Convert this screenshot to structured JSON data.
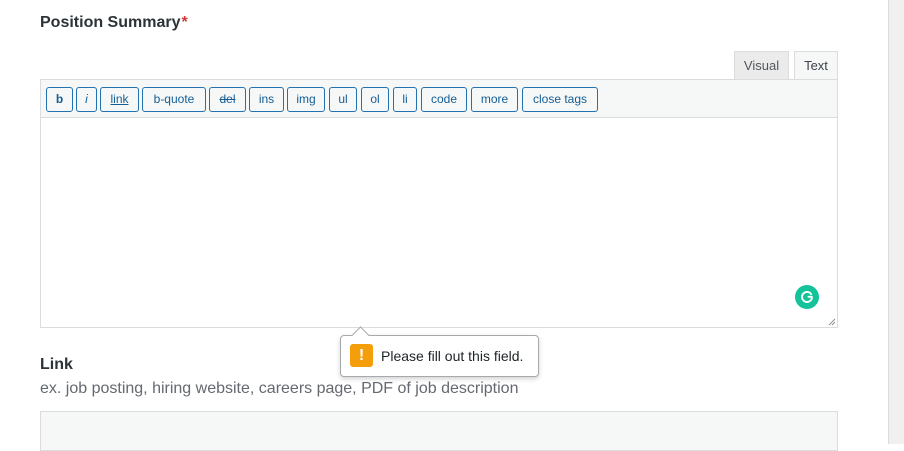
{
  "position_summary": {
    "label": "Position Summary",
    "required_mark": "*",
    "tabs": {
      "visual": "Visual",
      "text": "Text"
    },
    "toolbar": {
      "bold": "b",
      "italic": "i",
      "link": "link",
      "bquote": "b-quote",
      "del": "del",
      "ins": "ins",
      "img": "img",
      "ul": "ul",
      "ol": "ol",
      "li": "li",
      "code": "code",
      "more": "more",
      "close": "close tags"
    },
    "content": ""
  },
  "validation_tooltip": {
    "icon": "warning-icon",
    "message": "Please fill out this field."
  },
  "link_field": {
    "label": "Link",
    "description": "ex. job posting, hiring website, careers page, PDF of job description",
    "value": ""
  },
  "colors": {
    "button_blue": "#2271b1",
    "required_red": "#d63638",
    "grammarly_green": "#15c39a",
    "warning_orange": "#f59e0b"
  }
}
